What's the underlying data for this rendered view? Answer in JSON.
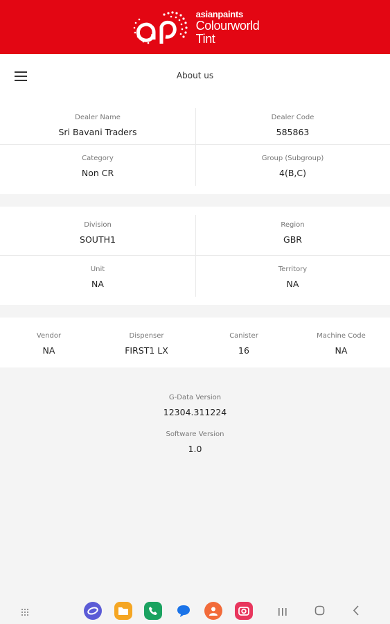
{
  "brand": {
    "line1": "asianpaints",
    "line2": "Colourworld",
    "line3": "Tint",
    "color": "#e30613"
  },
  "header": {
    "title": "About us",
    "menu_icon": "hamburger-menu-icon"
  },
  "dealer": {
    "name_label": "Dealer Name",
    "name": "Sri Bavani Traders",
    "code_label": "Dealer Code",
    "code": "585863",
    "category_label": "Category",
    "category": "Non CR",
    "group_label": "Group (Subgroup)",
    "group": "4(B,C)"
  },
  "region": {
    "division_label": "Division",
    "division": "SOUTH1",
    "region_label": "Region",
    "region": "GBR",
    "unit_label": "Unit",
    "unit": "NA",
    "territory_label": "Territory",
    "territory": "NA"
  },
  "machine": {
    "vendor_label": "Vendor",
    "vendor": "NA",
    "dispenser_label": "Dispenser",
    "dispenser": "FIRST1 LX",
    "canister_label": "Canister",
    "canister": "16",
    "machine_code_label": "Machine Code",
    "machine_code": "NA"
  },
  "versions": {
    "gdata_label": "G-Data Version",
    "gdata": "12304.311224",
    "software_label": "Software Version",
    "software": "1.0"
  },
  "navbar": {
    "apps": [
      {
        "icon": "internet-browser-icon",
        "color": "#5b5bd6"
      },
      {
        "icon": "my-files-icon",
        "color": "#f5a623"
      },
      {
        "icon": "phone-icon",
        "color": "#1aa260"
      },
      {
        "icon": "messages-icon",
        "color": "#1a73e8"
      },
      {
        "icon": "contacts-icon",
        "color": "#f26b3a"
      },
      {
        "icon": "camera-icon",
        "color": "#e8365d"
      }
    ]
  }
}
